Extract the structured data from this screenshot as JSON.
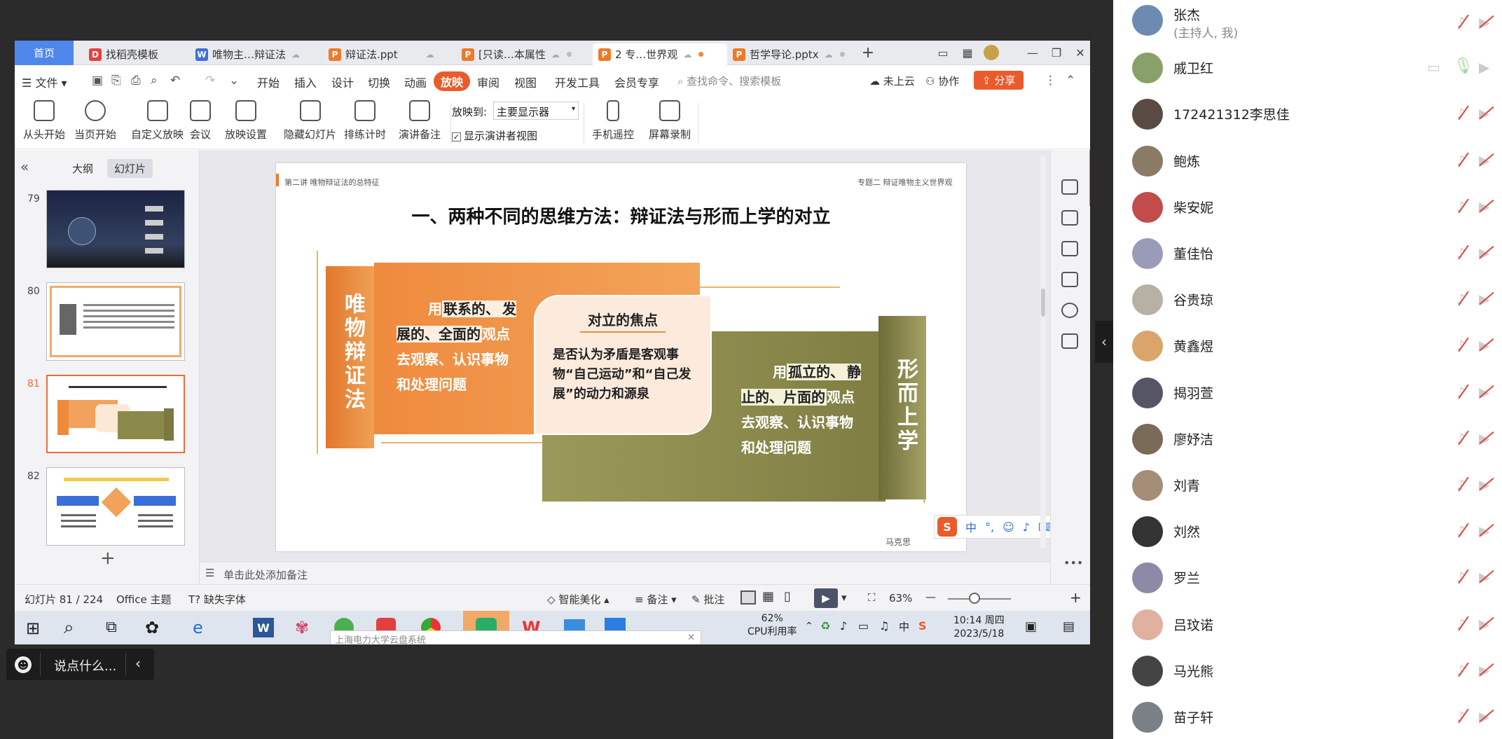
{
  "tabs": [
    {
      "label": "首页",
      "kind": "home"
    },
    {
      "label": "找稻壳模板",
      "icon": "docer-icon",
      "icon_color": "#e8403a"
    },
    {
      "label": "唯物主…辩证法",
      "icon": "word-icon",
      "icon_color": "#3f6fd8"
    },
    {
      "label": "辩证法.ppt",
      "icon": "ppt-icon",
      "icon_color": "#ee7a2a"
    },
    {
      "label": "[只读…本属性",
      "icon": "ppt-icon",
      "icon_color": "#ee7a2a"
    },
    {
      "label": "2 专…世界观",
      "icon": "ppt-icon",
      "icon_color": "#ee7a2a"
    },
    {
      "label": "哲学导论.pptx",
      "icon": "ppt-icon",
      "icon_color": "#ee7a2a"
    }
  ],
  "menu": {
    "file": "文件",
    "items": [
      "开始",
      "插入",
      "设计",
      "切换",
      "动画",
      "放映",
      "审阅",
      "视图",
      "开发工具",
      "会员专享"
    ],
    "active": "放映",
    "search_placeholder": "查找命令、搜索模板",
    "cloud": "未上云",
    "collab": "协作",
    "share": "分享"
  },
  "ribbon": {
    "from_start": "从头开始",
    "from_current": "当页开始",
    "custom_show": "自定义放映",
    "meeting": "会议",
    "show_settings": "放映设置",
    "hide_slide": "隐藏幻灯片",
    "rehearse": "排练计时",
    "presenter_notes": "演讲备注",
    "show_to_label": "放映到:",
    "show_to_value": "主要显示器",
    "presenter_view": "显示演讲者视图",
    "phone_remote": "手机遥控",
    "screen_record": "屏幕录制"
  },
  "left_panel": {
    "tab_outline": "大纲",
    "tab_slides": "幻灯片",
    "thumbs": [
      {
        "num": "79",
        "selected": false
      },
      {
        "num": "80",
        "selected": false
      },
      {
        "num": "81",
        "selected": true
      },
      {
        "num": "82",
        "selected": false
      }
    ]
  },
  "slide": {
    "header_left": "第二讲  唯物辩证法的总特征",
    "header_right": "专题二  辩证唯物主义世界观",
    "title": "一、两种不同的思维方法：辩证法与形而上学的对立",
    "left_label": "唯物辩证法",
    "left_text_prefix": "用",
    "left_text_bold1": "联系的、",
    "left_text_bold2": "发展的、全面的",
    "left_text_rest": "观点去观察、认识事物和处理问题",
    "center_title": "对立的焦点",
    "center_text": "是否认为矛盾是客观事物“自己运动”和“自己发展”的动力和源泉",
    "right_label": "形而上学",
    "right_text_prefix": "用",
    "right_text_bold1": "孤立的、",
    "right_text_bold2": "静止的、片面的",
    "right_text_rest": "观点去观察、认识事物和处理问题",
    "footer": "马克思"
  },
  "notes_placeholder": "单击此处添加备注",
  "status": {
    "slide_count": "幻灯片 81 / 224",
    "theme": "Office 主题",
    "missing_font": "缺失字体",
    "smart": "智能美化",
    "notes": "备注",
    "comment": "批注",
    "zoom": "63%"
  },
  "taskbar": {
    "app_tooltip": "上海电力大学云盘系统",
    "cpu_percent": "62%",
    "cpu_label": "CPU利用率",
    "time": "10:14 周四",
    "date": "2023/5/18",
    "ime": "中"
  },
  "chat": {
    "placeholder": "说点什么..."
  },
  "participants": [
    {
      "name": "张杰",
      "sub": "(主持人, 我)",
      "color": "#6d8bb0"
    },
    {
      "name": "戚卫红",
      "sub": "",
      "color": "#8aa06a"
    },
    {
      "name": "172421312李思佳",
      "sub": "",
      "color": "#5a4a44"
    },
    {
      "name": "鲍炼",
      "sub": "",
      "color": "#8a7a66"
    },
    {
      "name": "柴安妮",
      "sub": "",
      "color": "#c24b4b"
    },
    {
      "name": "董佳怡",
      "sub": "",
      "color": "#9a9bb8"
    },
    {
      "name": "谷贵琼",
      "sub": "",
      "color": "#b8b0a4"
    },
    {
      "name": "黄鑫煜",
      "sub": "",
      "color": "#d9a56a"
    },
    {
      "name": "揭羽萱",
      "sub": "",
      "color": "#555566"
    },
    {
      "name": "廖妤洁",
      "sub": "",
      "color": "#7a6a58"
    },
    {
      "name": "刘青",
      "sub": "",
      "color": "#a58e78"
    },
    {
      "name": "刘然",
      "sub": "",
      "color": "#333333"
    },
    {
      "name": "罗兰",
      "sub": "",
      "color": "#8c8aa6"
    },
    {
      "name": "吕玟诺",
      "sub": "",
      "color": "#e0b0a0"
    },
    {
      "name": "马光熊",
      "sub": "",
      "color": "#444444"
    },
    {
      "name": "苗子轩",
      "sub": "",
      "color": "#7a8088"
    }
  ],
  "colors": {
    "accent": "#ea5b2b",
    "orange": "#ee8a3a",
    "olive": "#8c8a4a",
    "tab_blue": "#4e87ec"
  }
}
